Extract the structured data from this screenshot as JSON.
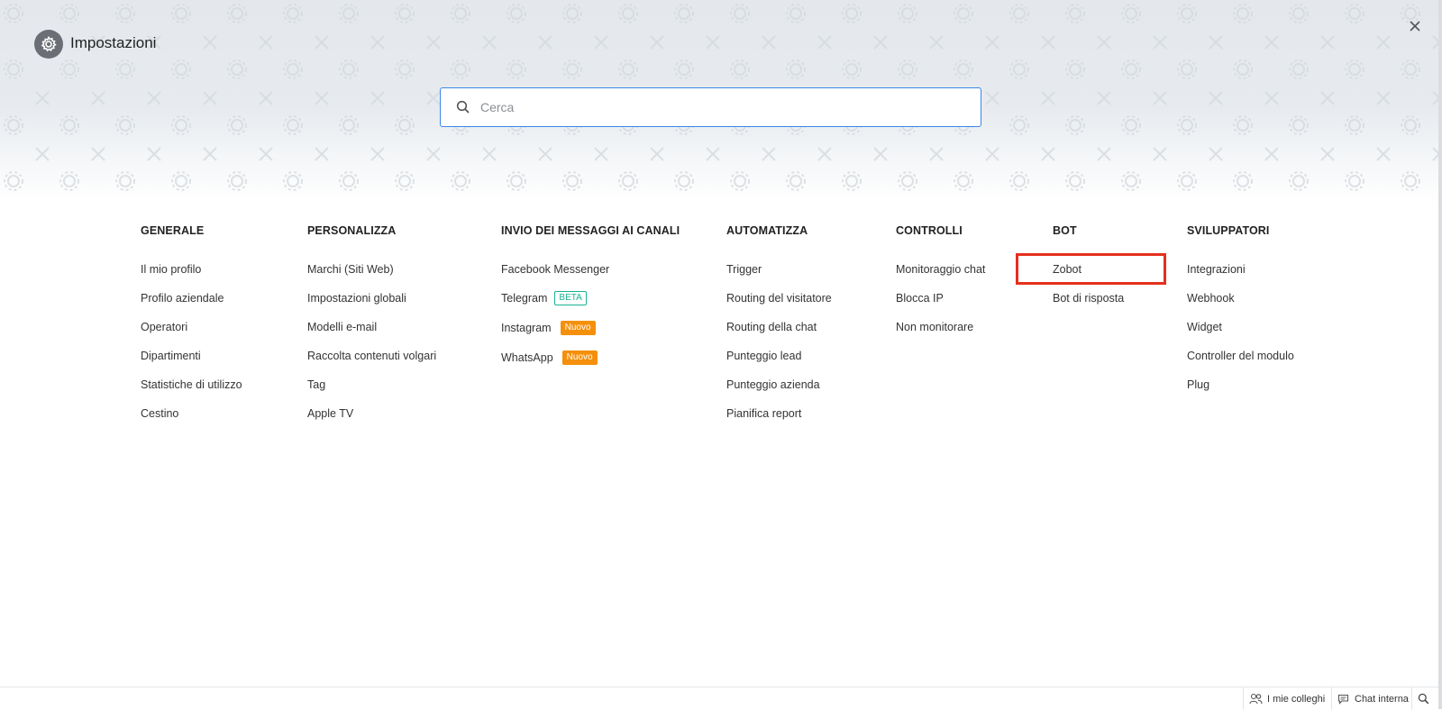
{
  "header": {
    "title": "Impostazioni",
    "settings_icon": "gear-icon",
    "close_icon": "close-icon"
  },
  "search": {
    "placeholder": "Cerca",
    "value": ""
  },
  "sections": [
    {
      "heading": "GENERALE",
      "items": [
        "Il mio profilo",
        "Profilo aziendale",
        "Operatori",
        "Dipartimenti",
        "Statistiche di utilizzo",
        "Cestino"
      ]
    },
    {
      "heading": "PERSONALIZZA",
      "items": [
        "Marchi (Siti Web)",
        "Impostazioni globali",
        "Modelli e-mail",
        "Raccolta contenuti volgari",
        "Tag",
        "Apple TV"
      ]
    },
    {
      "heading": "INVIO DEI MESSAGGI AI CANALI",
      "items": [
        "Facebook Messenger",
        "Telegram",
        "Instagram",
        "WhatsApp"
      ],
      "badges": {
        "telegram": "BETA",
        "instagram": "Nuovo",
        "whatsapp": "Nuovo"
      }
    },
    {
      "heading": "AUTOMATIZZA",
      "items": [
        "Trigger",
        "Routing del visitatore",
        "Routing della chat",
        "Punteggio lead",
        "Punteggio azienda",
        "Pianifica report"
      ]
    },
    {
      "heading": "CONTROLLI",
      "items": [
        "Monitoraggio chat",
        "Blocca IP",
        "Non monitorare"
      ]
    },
    {
      "heading": "BOT",
      "items": [
        "Zobot",
        "Bot di risposta"
      ]
    },
    {
      "heading": "SVILUPPATORI",
      "items": [
        "Integrazioni",
        "Webhook",
        "Widget",
        "Controller del modulo",
        "Plug"
      ]
    }
  ],
  "highlighted_item": "Zobot",
  "bottom_bar": {
    "colleagues_label": "I mie colleghi",
    "colleagues_icon": "people-icon",
    "chat_label": "Chat interna",
    "chat_icon": "chat-bubble-icon",
    "search_icon": "search-icon"
  },
  "colors": {
    "accent": "#3a86e8",
    "highlight": "#e5301d",
    "beta": "#19b394",
    "new_badge": "#f4900c"
  }
}
